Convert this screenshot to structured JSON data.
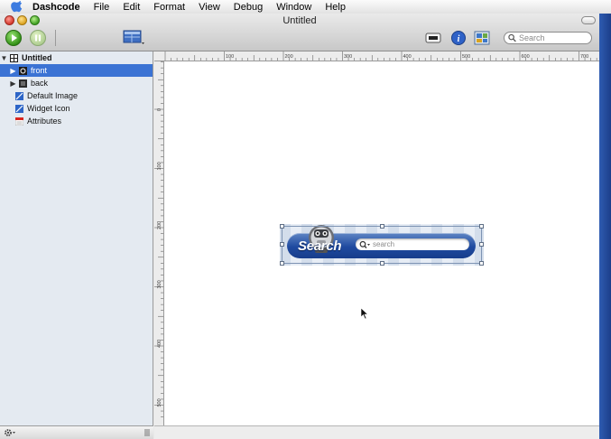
{
  "menubar": {
    "app": "Dashcode",
    "items": [
      "File",
      "Edit",
      "Format",
      "View",
      "Debug",
      "Window",
      "Help"
    ]
  },
  "window": {
    "title": "Untitled"
  },
  "toolbar": {
    "search_placeholder": "Search"
  },
  "sidebar": {
    "root": "Untitled",
    "items": {
      "front": "front",
      "back": "back",
      "default_image": "Default Image",
      "widget_icon": "Widget Icon",
      "attributes": "Attributes"
    },
    "selected": "front"
  },
  "ruler": {
    "horizontal": [
      "100",
      "200",
      "300",
      "400",
      "500",
      "600",
      "700"
    ],
    "vertical": [
      "0",
      "100",
      "200",
      "300",
      "400",
      "500"
    ]
  },
  "widget": {
    "label": "Search",
    "field_placeholder": "search"
  },
  "colors": {
    "selection": "#3b73d4",
    "widget_bar": "#1f4aa0",
    "sidebar_bg": "#e4eaf1"
  }
}
